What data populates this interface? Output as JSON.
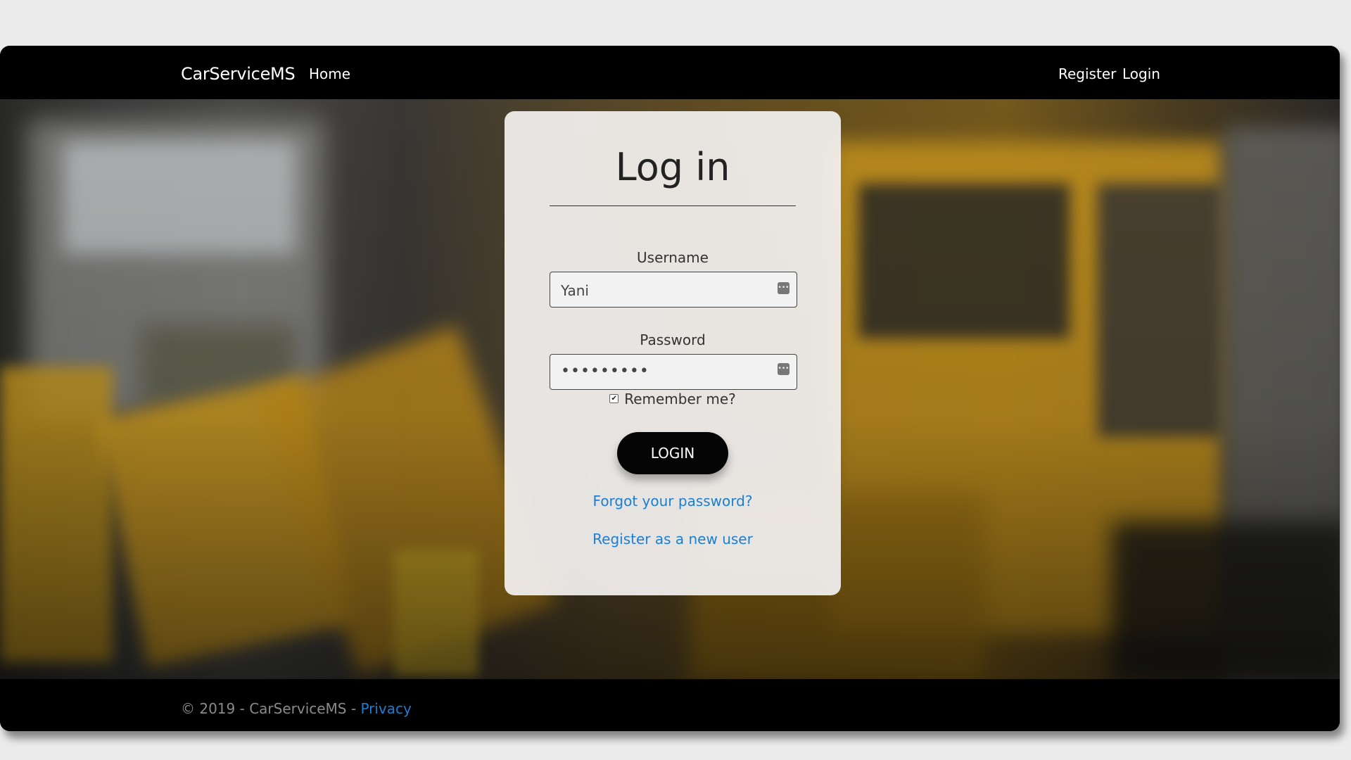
{
  "navbar": {
    "brand": "CarServiceMS",
    "home": "Home",
    "register": "Register",
    "login": "Login"
  },
  "login_card": {
    "title": "Log in",
    "username_label": "Username",
    "username_value": "Yani",
    "password_label": "Password",
    "password_value": "•••••••••",
    "remember_label": "Remember me?",
    "remember_checked": true,
    "submit_label": "LOGIN",
    "forgot_link": "Forgot your password?",
    "register_link": "Register as a new user"
  },
  "footer": {
    "copyright": "© 2019 - CarServiceMS - ",
    "privacy": "Privacy"
  },
  "colors": {
    "link": "#1a7fd4",
    "navbar_bg": "#000000",
    "button_bg": "#050505"
  },
  "icons": {
    "field_key": "password-manager-key-icon",
    "checkbox": "checkmark-icon"
  }
}
